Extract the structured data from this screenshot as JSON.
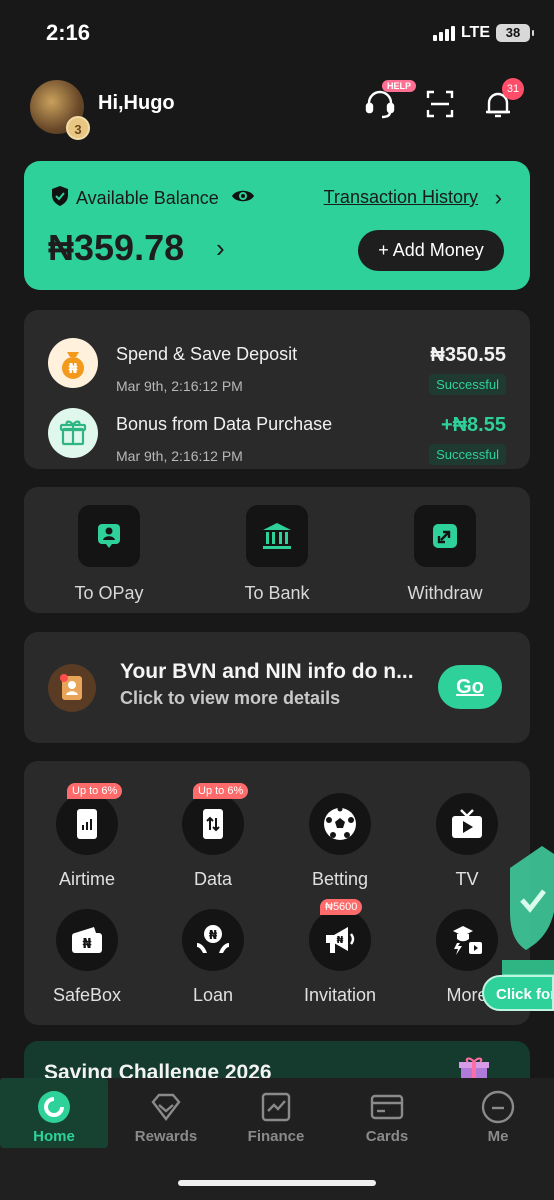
{
  "status_bar": {
    "time": "2:16",
    "network": "LTE",
    "battery": "38"
  },
  "header": {
    "greeting": "Hi,Hugo",
    "avatar_level": "3",
    "help_tag": "HELP",
    "notification_count": "31"
  },
  "balance": {
    "label": "Available Balance",
    "amount": "₦359.78",
    "history_link": "Transaction History",
    "add_money": "+ Add Money",
    "card_color": "#2fd19a"
  },
  "transactions": [
    {
      "title": "Spend & Save Deposit",
      "date": "Mar 9th, 2:16:12 PM",
      "amount": "₦350.55",
      "status": "Successful",
      "icon": "money-bag-icon"
    },
    {
      "title": "Bonus from Data Purchase",
      "date": "Mar 9th, 2:16:12 PM",
      "amount": "+₦8.55",
      "status": "Successful",
      "icon": "gift-icon"
    }
  ],
  "quick_actions": [
    {
      "label": "To OPay",
      "icon": "opay-contact-icon"
    },
    {
      "label": "To Bank",
      "icon": "bank-icon"
    },
    {
      "label": "Withdraw",
      "icon": "withdraw-icon"
    }
  ],
  "bvn_banner": {
    "title": "Your BVN and NIN info do n...",
    "subtitle": "Click to view more details",
    "button": "Go"
  },
  "services": [
    {
      "label": "Airtime",
      "badge": "Up to 6%",
      "icon": "phone-icon"
    },
    {
      "label": "Data",
      "badge": "Up to 6%",
      "icon": "data-icon"
    },
    {
      "label": "Betting",
      "badge": "",
      "icon": "soccer-ball-icon"
    },
    {
      "label": "TV",
      "badge": "",
      "icon": "tv-icon"
    },
    {
      "label": "SafeBox",
      "badge": "",
      "icon": "wallet-icon"
    },
    {
      "label": "Loan",
      "badge": "",
      "icon": "loan-icon"
    },
    {
      "label": "Invitation",
      "badge": "₦5600",
      "icon": "megaphone-icon"
    },
    {
      "label": "More",
      "badge": "",
      "icon": "more-icon"
    }
  ],
  "promo": {
    "button": "Click for"
  },
  "saving_challenge": {
    "title": "Saving Challenge 2026"
  },
  "bottom_nav": [
    {
      "label": "Home",
      "icon": "home-icon",
      "active": true
    },
    {
      "label": "Rewards",
      "icon": "rewards-icon",
      "active": false
    },
    {
      "label": "Finance",
      "icon": "finance-icon",
      "active": false
    },
    {
      "label": "Cards",
      "icon": "card-icon",
      "active": false
    },
    {
      "label": "Me",
      "icon": "profile-icon",
      "active": false
    }
  ]
}
